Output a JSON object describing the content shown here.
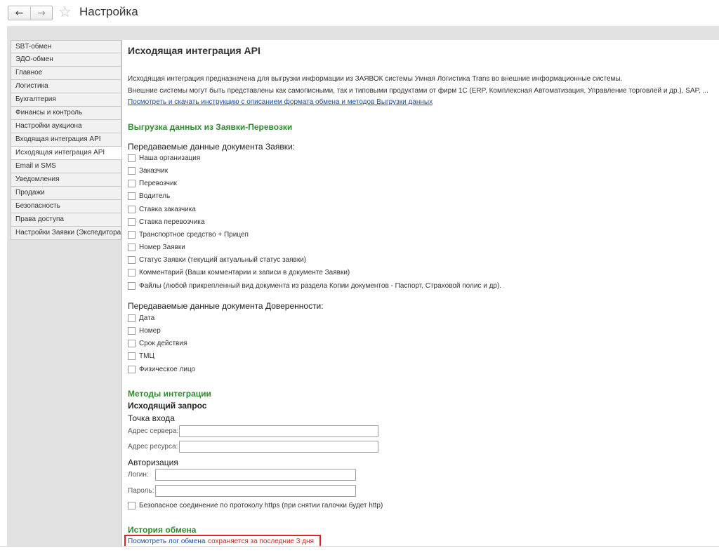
{
  "window": {
    "title": "Настройка",
    "back_icon": "←",
    "forward_icon": "→",
    "star_icon": "☆"
  },
  "sidebar": {
    "items": [
      {
        "label": "SBT-обмен"
      },
      {
        "label": "ЭДО-обмен"
      },
      {
        "label": "Главное"
      },
      {
        "label": "Логистика"
      },
      {
        "label": "Бухгалтерия"
      },
      {
        "label": "Финансы и контроль"
      },
      {
        "label": "Настройки аукциона"
      },
      {
        "label": "Входящая интеграция API"
      },
      {
        "label": "Исходящая интеграция API"
      },
      {
        "label": "Email и SMS"
      },
      {
        "label": "Уведомления"
      },
      {
        "label": "Продажи"
      },
      {
        "label": "Безопасность"
      },
      {
        "label": "Права доступа"
      },
      {
        "label": "Настройки Заявки (Экспедитора)"
      }
    ],
    "active": "Исходящая интеграция API"
  },
  "main": {
    "title": "Исходящая интеграция API",
    "description_1": "Исходящая интеграция предназначена для выгрузки информации из ЗАЯВОК системы Умная Логистика Trans во внешние информационные системы.",
    "description_2": "Внешние системы могут быть представлены как самописными, так и типовыми продуктами от фирм 1С (ERP, Комплексная Автоматизация, Управление торговлей и др.), SAP, ...",
    "instruction_link": "Посмотреть и скачать инструкцию с описанием формата обмена и методов Выгрузки данных",
    "export_section": {
      "heading": "Выгрузка данных из Заявки-Перевозки",
      "order_group_label": "Передаваемые данные документа Заявки:",
      "order_checkboxes": [
        {
          "label": "Наша организация"
        },
        {
          "label": "Заказчик"
        },
        {
          "label": "Перевозчик"
        },
        {
          "label": "Водитель"
        },
        {
          "label": "Ставка заказчика"
        },
        {
          "label": "Ставка перевозчика"
        },
        {
          "label": "Транспортное средство + Прицеп"
        },
        {
          "label": "Номер Заявки"
        },
        {
          "label": "Статус Заявки (текущий актуальный статус заявки)"
        },
        {
          "label": "Комментарий (Ваши комментарии и записи в документе Заявки)"
        },
        {
          "label": "Файлы (любой прикрепленный вид документа из раздела Копии документов - Паспорт, Страховой полис и др)."
        }
      ],
      "proxy_group_label": "Передаваемые данные документа Доверенности:",
      "proxy_checkboxes": [
        {
          "label": "Дата"
        },
        {
          "label": "Номер"
        },
        {
          "label": "Срок действия"
        },
        {
          "label": "ТМЦ"
        },
        {
          "label": "Физическое лицо"
        }
      ]
    },
    "methods": {
      "heading": "Методы интеграции",
      "outgoing_request": "Исходящий запрос",
      "entry_point": "Точка входа",
      "server_label": "Адрес сервера:",
      "server_value": "",
      "resource_label": "Адрес ресурса:",
      "resource_value": "",
      "auth": "Авторизация",
      "login_label": "Логин:",
      "login_value": "",
      "password_label": "Пароль:",
      "password_value": "",
      "https_checkbox": "Безопасное соединение по протоколу https (при снятии галочки будет http)"
    },
    "history": {
      "heading": "История обмена",
      "log_link": "Посмотреть лог обмена",
      "note": "сохраняется за последние 3 дня"
    }
  },
  "colors": {
    "section_heading": "#2e8b2e",
    "link": "#1a4ea8",
    "highlight_border": "#d9262d",
    "note": "#c62828"
  }
}
